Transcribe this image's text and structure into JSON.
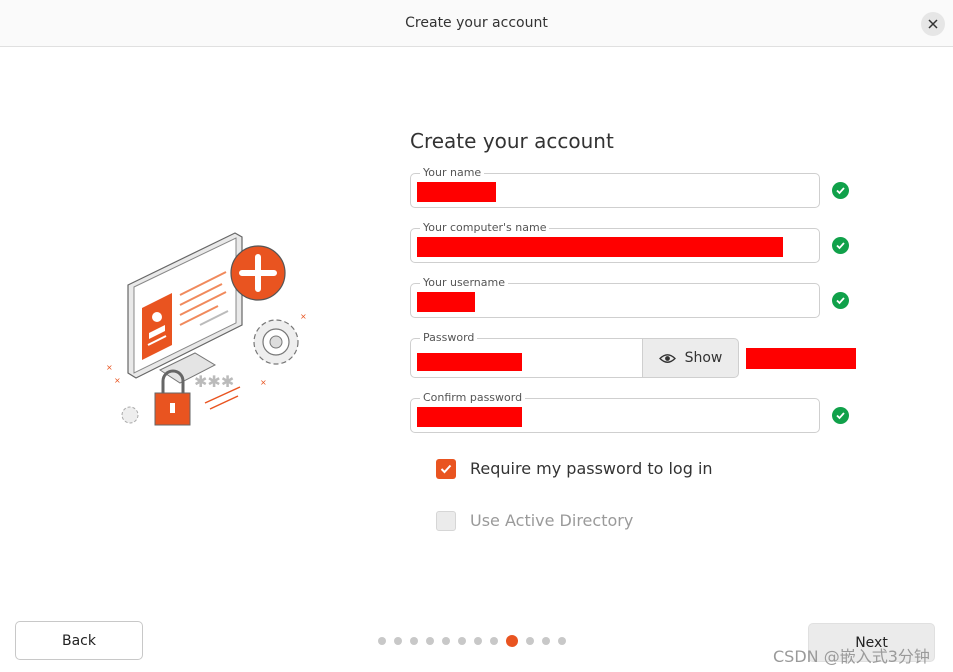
{
  "window": {
    "title": "Create your account"
  },
  "form": {
    "heading": "Create your account",
    "fields": [
      {
        "label": "Your name"
      },
      {
        "label": "Your computer's name"
      },
      {
        "label": "Your username"
      },
      {
        "label": "Password"
      },
      {
        "label": "Confirm password"
      }
    ],
    "show_label": "Show",
    "require_password_label": "Require my password to log in",
    "active_directory_label": "Use Active Directory"
  },
  "footer": {
    "back_label": "Back",
    "next_label": "Next",
    "step_count": 12,
    "active_step": 9
  },
  "watermark": "CSDN @嵌入式3分钟",
  "colors": {
    "accent": "#e95420",
    "valid": "#10a14a",
    "redaction": "#ff0000"
  },
  "icons": [
    "close-icon",
    "check-circle-icon",
    "eye-icon",
    "checkmark-icon"
  ]
}
